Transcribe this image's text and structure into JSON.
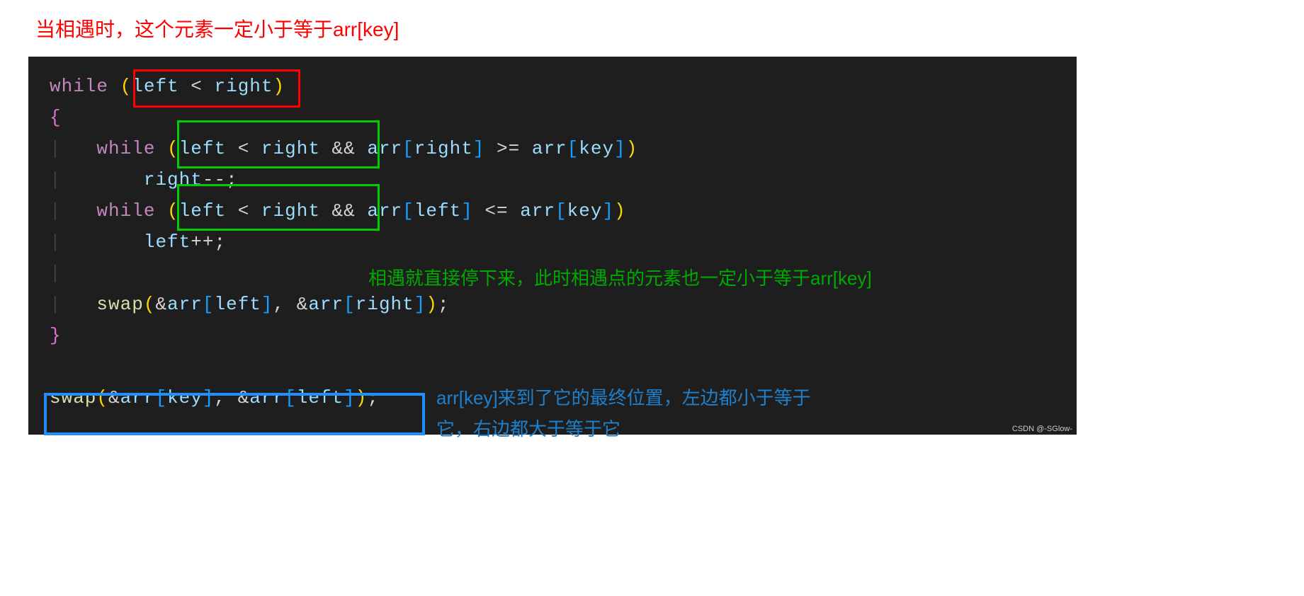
{
  "annotations": {
    "title": "当相遇时，这个元素一定小于等于arr[key]",
    "green_note": "相遇就直接停下来，此时相遇点的元素也一定小于等于arr[key]",
    "blue_note_line1": "arr[key]来到了它的最终位置，左边都小于等于",
    "blue_note_line2": "它，右边都大于等于它",
    "watermark": "CSDN @-SGlow-"
  },
  "code": {
    "line1_while": "while",
    "line1_left": "left",
    "line1_right": "right",
    "line4_while": "while",
    "line4_left": "left",
    "line4_right": "right",
    "line4_arr1": "arr",
    "line4_right2": "right",
    "line4_arr2": "arr",
    "line4_key": "key",
    "line5_right": "right",
    "line6_while": "while",
    "line6_left": "left",
    "line6_right": "right",
    "line6_arr1": "arr",
    "line6_left2": "left",
    "line6_arr2": "arr",
    "line6_key": "key",
    "line7_left": "left",
    "line9_swap": "swap",
    "line9_arr1": "arr",
    "line9_left": "left",
    "line9_arr2": "arr",
    "line9_right": "right",
    "line12_swap": "swap",
    "line12_arr1": "arr",
    "line12_key": "key",
    "line12_arr2": "arr",
    "line12_left": "left"
  }
}
